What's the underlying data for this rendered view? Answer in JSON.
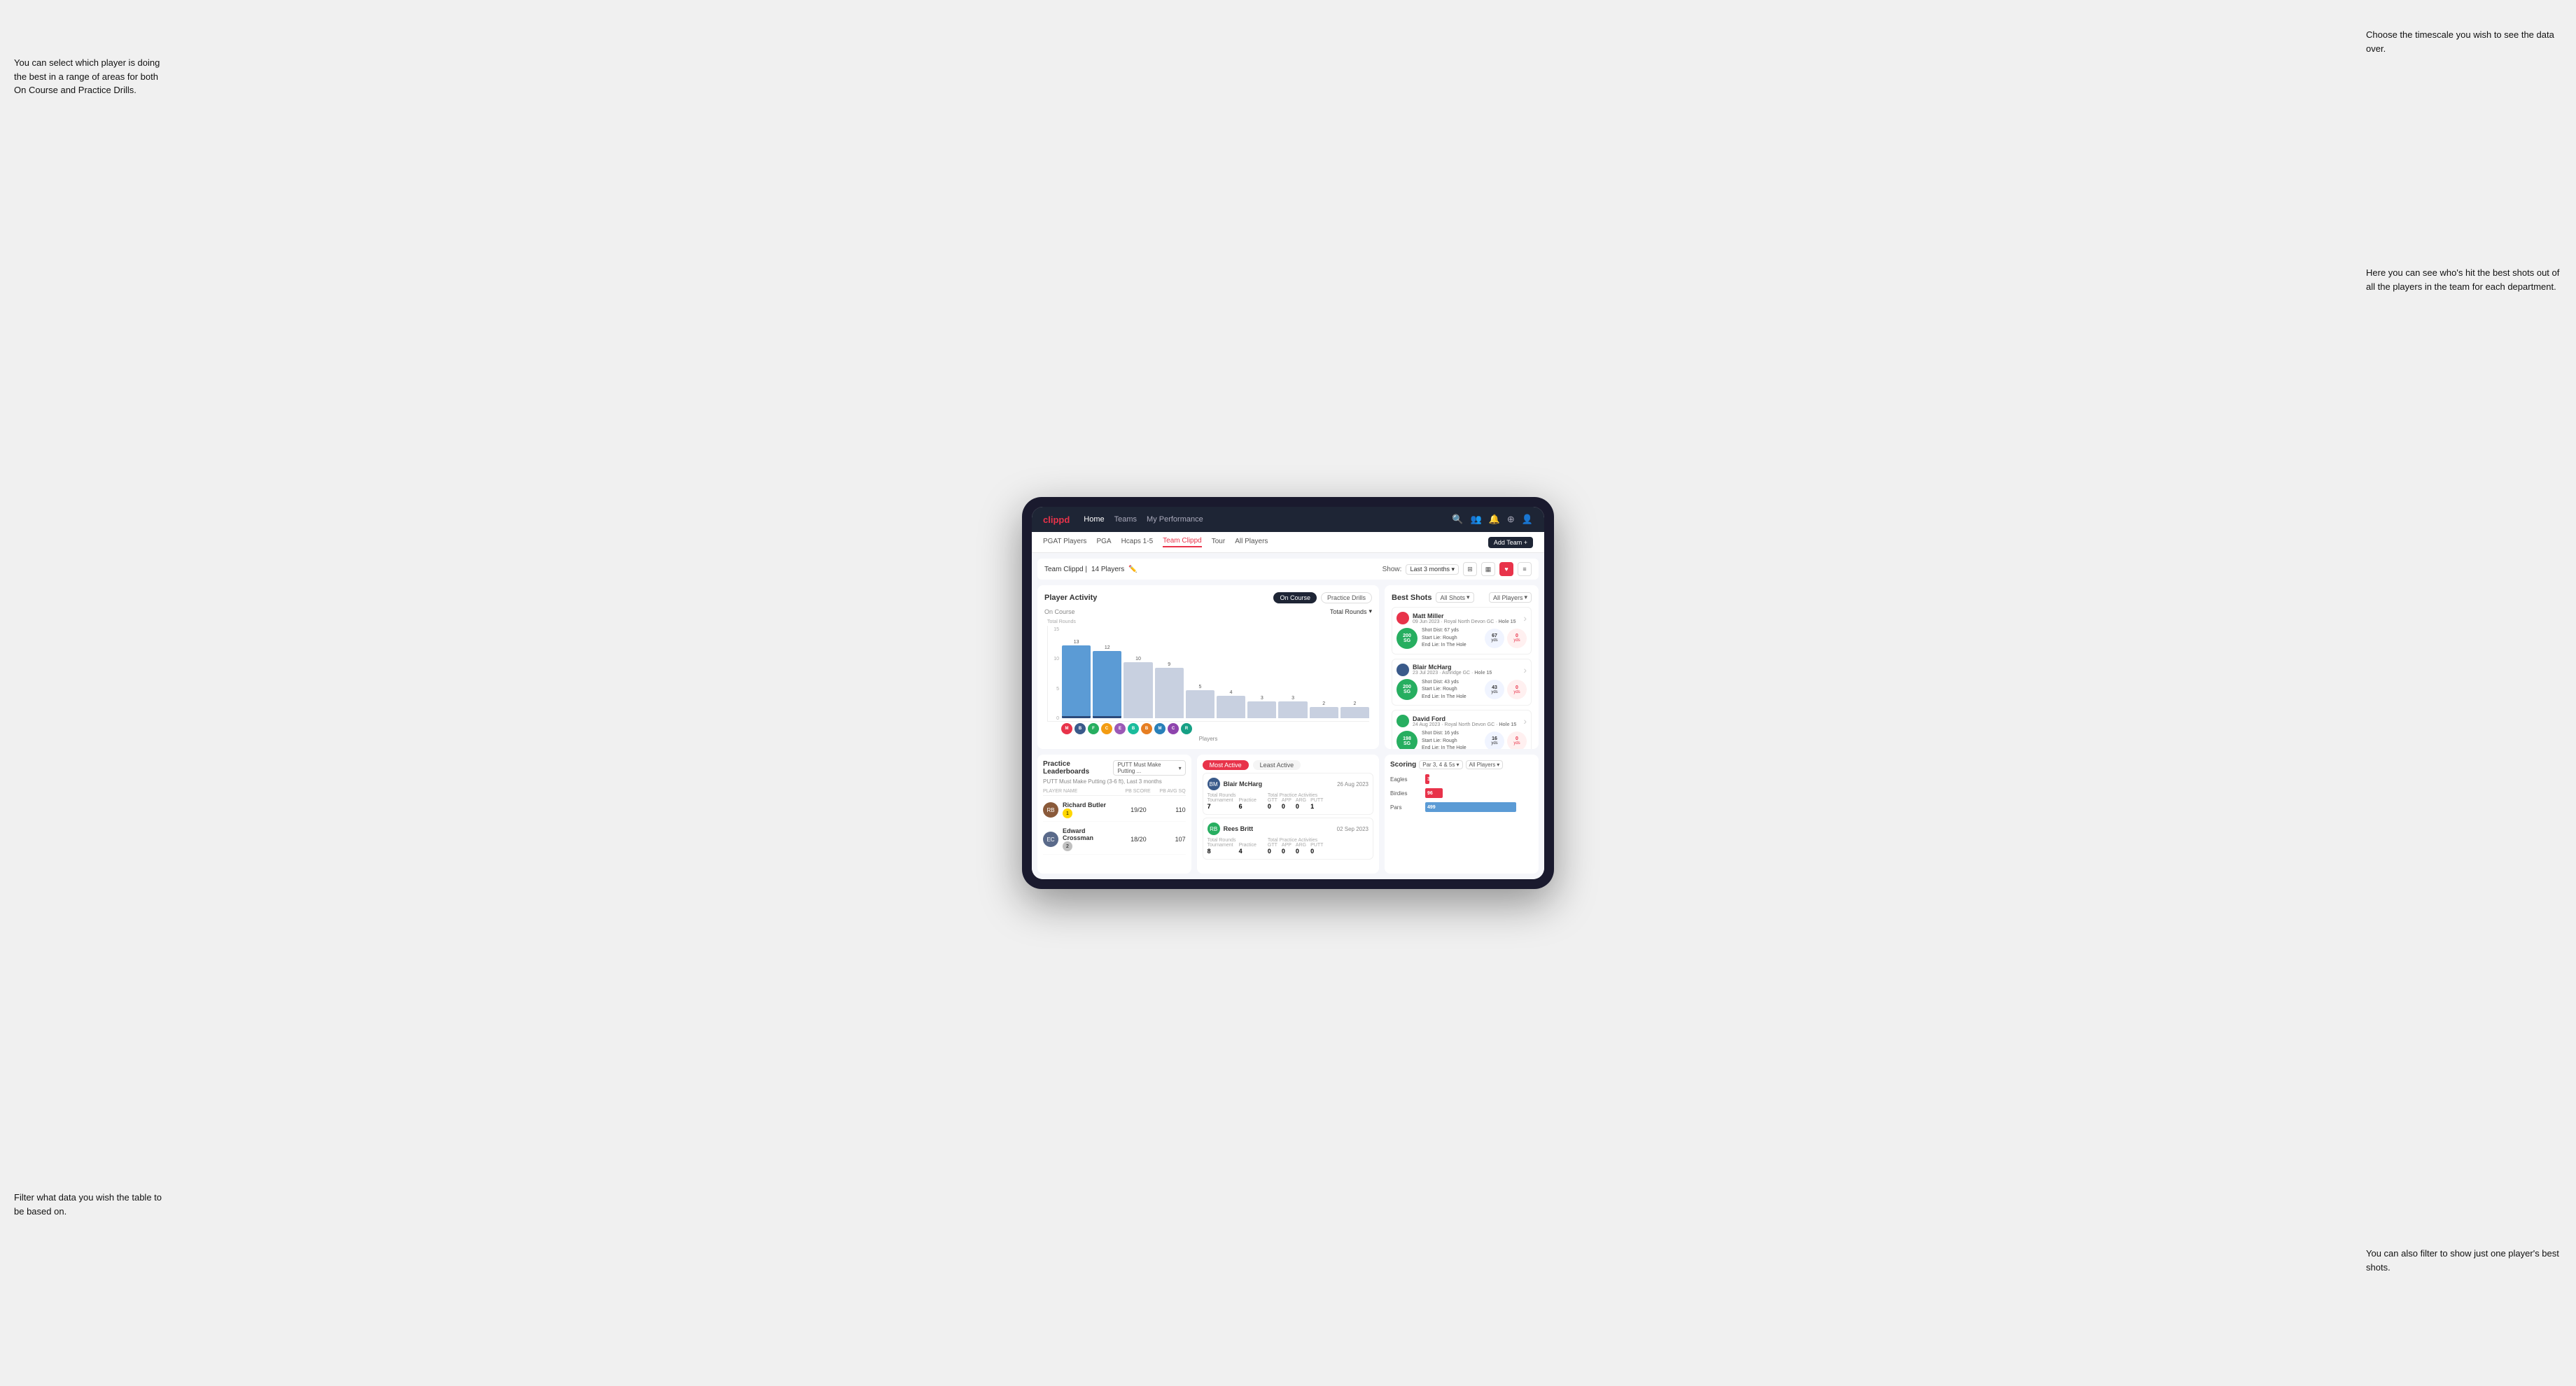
{
  "annotations": {
    "top_left": "You can select which player is doing the best in a range of areas for both On Course and Practice Drills.",
    "bottom_left": "Filter what data you wish the table to be based on.",
    "top_right": "Choose the timescale you wish to see the data over.",
    "mid_right": "Here you can see who's hit the best shots out of all the players in the team for each department.",
    "bot_right": "You can also filter to show just one player's best shots."
  },
  "nav": {
    "logo": "clippd",
    "items": [
      "Home",
      "Teams",
      "My Performance"
    ],
    "icons": [
      "🔍",
      "👤",
      "🔔",
      "⊕",
      "👤"
    ]
  },
  "sub_nav": {
    "items": [
      "PGAT Players",
      "PGA",
      "Hcaps 1-5",
      "Team Clippd",
      "Tour",
      "All Players"
    ],
    "active": "Team Clippd",
    "add_team_btn": "Add Team +"
  },
  "team_header": {
    "team_name": "Team Clippd",
    "player_count": "14 Players",
    "show_label": "Show:",
    "time_filter": "Last 3 months",
    "views": [
      "grid",
      "card",
      "heart",
      "list"
    ]
  },
  "player_activity": {
    "title": "Player Activity",
    "tabs": [
      "On Course",
      "Practice Drills"
    ],
    "active_tab": "On Course",
    "section_title": "On Course",
    "chart_filter": "Total Rounds",
    "y_labels": [
      "15",
      "10",
      "5",
      "0"
    ],
    "bars": [
      {
        "name": "B. McHarg",
        "value": 13,
        "highlighted": true
      },
      {
        "name": "B. Britt",
        "value": 12,
        "highlighted": true
      },
      {
        "name": "D. Ford",
        "value": 10,
        "highlighted": false
      },
      {
        "name": "J. Coles",
        "value": 9,
        "highlighted": false
      },
      {
        "name": "E. Ebert",
        "value": 5,
        "highlighted": false
      },
      {
        "name": "O. Billingham",
        "value": 4,
        "highlighted": false
      },
      {
        "name": "R. Butler",
        "value": 3,
        "highlighted": false
      },
      {
        "name": "M. Miller",
        "value": 3,
        "highlighted": false
      },
      {
        "name": "E. Crossman",
        "value": 2,
        "highlighted": false
      },
      {
        "name": "L. Robertson",
        "value": 2,
        "highlighted": false
      }
    ],
    "x_axis_label": "Players",
    "y_axis_label": "Total Rounds"
  },
  "best_shots": {
    "title": "Best Shots",
    "filter1": "All Shots",
    "filter2": "All Players",
    "players": [
      {
        "name": "Matt Miller",
        "date": "09 Jun 2023",
        "course": "Royal North Devon GC",
        "hole": "Hole 15",
        "badge": "200",
        "badge_suffix": "SG",
        "stats": "Shot Dist: 67 yds\nStart Lie: Rough\nEnd Lie: In The Hole",
        "yds1": "67",
        "yds1_label": "yds",
        "yds2": "0",
        "yds2_label": "yds"
      },
      {
        "name": "Blair McHarg",
        "date": "23 Jul 2023",
        "course": "Ashridge GC",
        "hole": "Hole 15",
        "badge": "200",
        "badge_suffix": "SG",
        "stats": "Shot Dist: 43 yds\nStart Lie: Rough\nEnd Lie: In The Hole",
        "yds1": "43",
        "yds1_label": "yds",
        "yds2": "0",
        "yds2_label": "yds"
      },
      {
        "name": "David Ford",
        "date": "24 Aug 2023",
        "course": "Royal North Devon GC",
        "hole": "Hole 15",
        "badge": "198",
        "badge_suffix": "SG",
        "stats": "Shot Dist: 16 yds\nStart Lie: Rough\nEnd Lie: In The Hole",
        "yds1": "16",
        "yds1_label": "yds",
        "yds2": "0",
        "yds2_label": "yds"
      }
    ]
  },
  "practice_leaderboards": {
    "title": "Practice Leaderboards",
    "filter": "PUTT Must Make Putting ...",
    "subtitle": "PUTT Must Make Putting (3-6 ft), Last 3 months",
    "cols": [
      "PLAYER NAME",
      "PB SCORE",
      "PB AVG SQ"
    ],
    "rows": [
      {
        "name": "Richard Butler",
        "rank": "1",
        "rank_type": "gold",
        "pb_score": "19/20",
        "pb_avg": "110"
      },
      {
        "name": "Edward Crossman",
        "rank": "2",
        "rank_type": "silver",
        "pb_score": "18/20",
        "pb_avg": "107"
      }
    ]
  },
  "most_active": {
    "tabs": [
      "Most Active",
      "Least Active"
    ],
    "active_tab": "Most Active",
    "players": [
      {
        "name": "Blair McHarg",
        "date": "26 Aug 2023",
        "total_rounds_label": "Total Rounds",
        "tournament": "7",
        "practice": "6",
        "total_practice_label": "Total Practice Activities",
        "gtt": "0",
        "app": "0",
        "arg": "0",
        "putt": "1"
      },
      {
        "name": "Rees Britt",
        "date": "02 Sep 2023",
        "total_rounds_label": "Total Rounds",
        "tournament": "8",
        "practice": "4",
        "total_practice_label": "Total Practice Activities",
        "gtt": "0",
        "app": "0",
        "arg": "0",
        "putt": "0"
      }
    ]
  },
  "scoring": {
    "title": "Scoring",
    "filter1": "Par 3, 4 & 5s",
    "filter2": "All Players",
    "bars": [
      {
        "label": "Eagles",
        "value": 3,
        "max": 500,
        "color": "eagles"
      },
      {
        "label": "Birdies",
        "value": 96,
        "max": 500,
        "color": "birdies"
      },
      {
        "label": "Pars",
        "value": 499,
        "max": 500,
        "color": "pars"
      }
    ]
  },
  "avatar_colors": [
    "#e8334a",
    "#3a5a8a",
    "#27ae60",
    "#f39c12",
    "#9b59b6",
    "#1abc9c",
    "#e67e22",
    "#2980b9",
    "#8e44ad",
    "#16a085"
  ]
}
